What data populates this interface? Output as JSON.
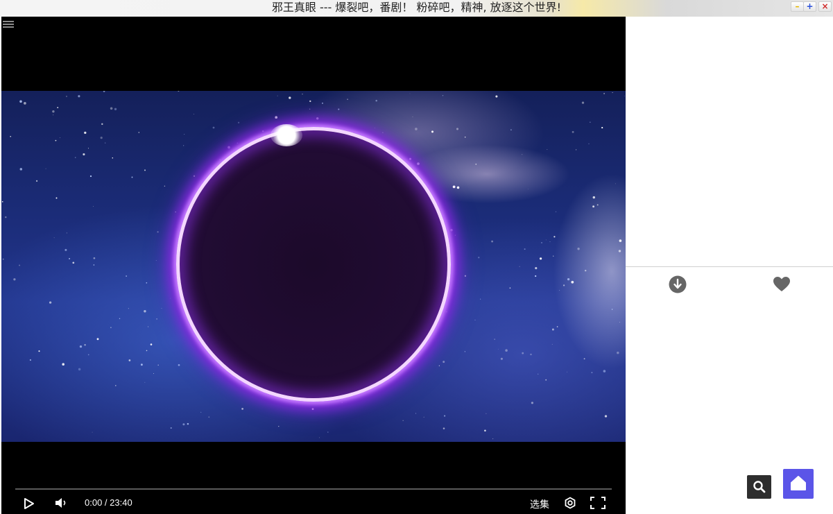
{
  "window": {
    "title": "邪王真眼 --- 爆裂吧，番剧！ 粉碎吧，精神, 放逐这个世界!",
    "minimize_icon": "minimize-icon",
    "maximize_icon": "maximize-icon",
    "close_icon": "close-icon"
  },
  "player": {
    "menu_icon": "hamburger-menu-icon",
    "progress_fraction": 0.0,
    "time_display": "0:00 / 23:40",
    "episodes_label": "选集",
    "icons": {
      "play": "play-icon",
      "volume": "volume-icon",
      "settings": "settings-icon",
      "fullscreen": "fullscreen-icon"
    }
  },
  "side_panel": {
    "download_icon": "download-icon",
    "favorite_icon": "heart-icon"
  },
  "floating_buttons": {
    "search_icon": "search-icon",
    "home_icon": "home-icon"
  },
  "colors": {
    "home_button": "#5b55e8",
    "search_button": "#2e2e2e",
    "icon_gray": "#666666",
    "ring_glow": "#8a2be2"
  }
}
